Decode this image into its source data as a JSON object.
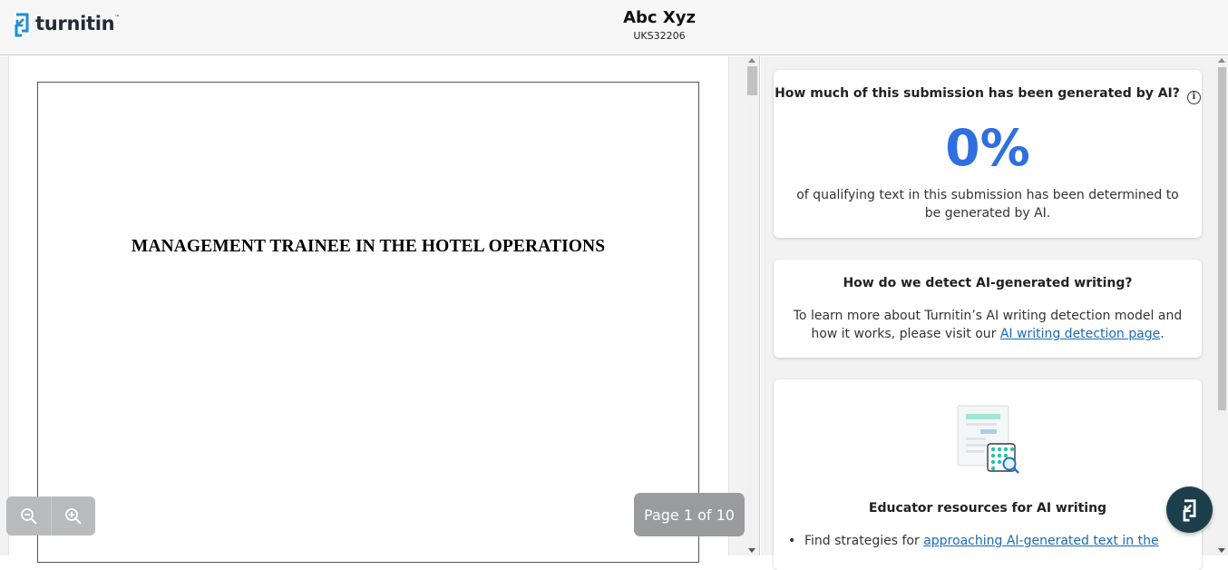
{
  "header": {
    "logo_text": "turnitin",
    "logo_tm": "™",
    "student_name": "Abc Xyz",
    "submission_id": "UKS32206"
  },
  "viewer": {
    "document_heading": "MANAGEMENT TRAINEE IN THE HOTEL OPERATIONS",
    "page_indicator": "Page 1 of 10",
    "zoom_out_icon": "zoom-out-icon",
    "zoom_in_icon": "zoom-in-icon"
  },
  "panel": {
    "ai_score_card": {
      "question": "How much of this submission has been generated by AI?",
      "info_icon": "i",
      "percent": "0%",
      "description": "of qualifying text in this submission has been determined to be generated by AI."
    },
    "detect_card": {
      "heading": "How do we detect AI-generated writing?",
      "body_prefix": "To learn more about Turnitin’s AI writing detection model and how it works, please visit our ",
      "link_text": "AI writing detection page",
      "body_suffix": "."
    },
    "resources_card": {
      "heading": "Educator resources for AI writing",
      "item_prefix": "Find strategies for ",
      "item_link": "approaching AI-generated text in the"
    }
  },
  "colors": {
    "accent_blue": "#2f6fe0",
    "link_blue": "#1a6bb8",
    "fab_bg": "#1d3f4b",
    "logo_blue": "#1e8fd6"
  }
}
